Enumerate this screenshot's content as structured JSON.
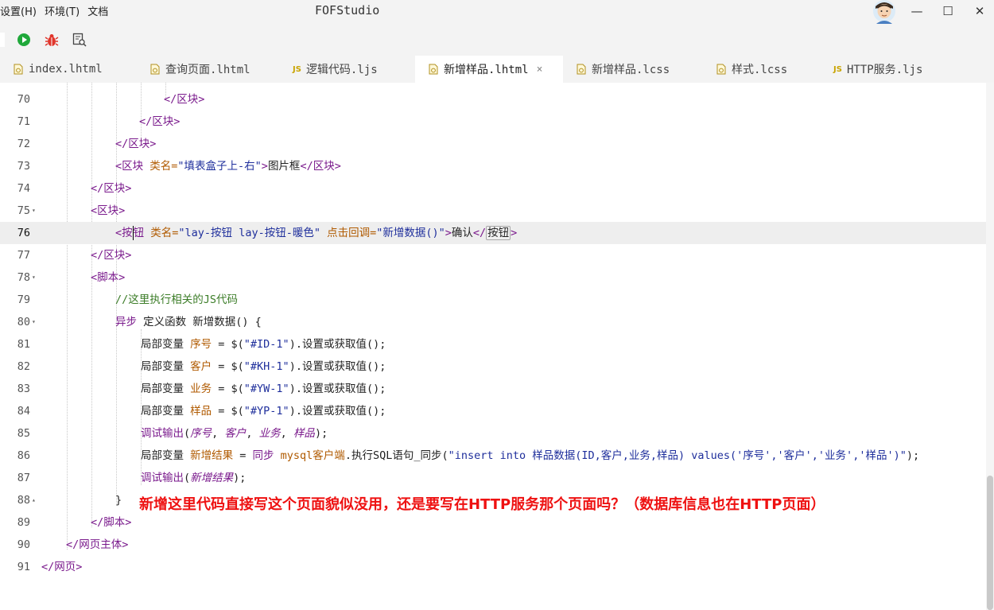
{
  "menu": {
    "settings": "设置(H)",
    "environment": "环境(T)",
    "docs": "文档"
  },
  "app_title": "FOFStudio",
  "window": {
    "minimize": "—",
    "maximize": "☐",
    "close": "✕"
  },
  "tabs": [
    {
      "label": "index.lhtml",
      "kind": "file"
    },
    {
      "label": "查询页面.lhtml",
      "kind": "file"
    },
    {
      "label": "逻辑代码.ljs",
      "kind": "js"
    },
    {
      "label": "新增样品.lhtml",
      "kind": "file",
      "active": true
    },
    {
      "label": "新增样品.lcss",
      "kind": "file"
    },
    {
      "label": "样式.lcss",
      "kind": "file"
    },
    {
      "label": "HTTP服务.ljs",
      "kind": "js"
    }
  ],
  "tab_close": "×",
  "js_badge": "JS",
  "current_line": "76",
  "lines": [
    {
      "n": "70",
      "code": [
        [
          "t",
          "</区块>"
        ]
      ]
    },
    {
      "n": "71",
      "code": [
        [
          "t",
          "</区块>"
        ]
      ]
    },
    {
      "n": "72",
      "code": [
        [
          "t",
          "</区块>"
        ]
      ]
    },
    {
      "n": "73",
      "code": [
        [
          "t",
          "<区块 "
        ],
        [
          "a",
          "类名="
        ],
        [
          "s",
          "\"填表盒子上-右\""
        ],
        [
          "t",
          ">"
        ],
        [
          "p",
          "图片框"
        ],
        [
          "t",
          "</区块>"
        ]
      ]
    },
    {
      "n": "74",
      "code": [
        [
          "t",
          "</区块>"
        ]
      ]
    },
    {
      "n": "75",
      "fold": "▾",
      "code": [
        [
          "t",
          "<区块>"
        ]
      ]
    },
    {
      "n": "76",
      "code": [
        [
          "t",
          "<按"
        ],
        [
          "caret",
          ""
        ],
        [
          "t",
          "钮 "
        ],
        [
          "a",
          "类名="
        ],
        [
          "s",
          "\"lay-按钮 lay-按钮-暖色\" "
        ],
        [
          "a",
          "点击回调="
        ],
        [
          "s",
          "\"新增数据()\""
        ],
        [
          "t",
          ">"
        ],
        [
          "p",
          "确认"
        ],
        [
          "t",
          "</"
        ],
        [
          "hl",
          "按钮"
        ],
        [
          "t",
          ">"
        ]
      ]
    },
    {
      "n": "77",
      "code": [
        [
          "t",
          "</区块>"
        ]
      ]
    },
    {
      "n": "78",
      "fold": "▾",
      "code": [
        [
          "t",
          "<脚本>"
        ]
      ]
    },
    {
      "n": "79",
      "code": [
        [
          "cm",
          "//这里执行相关的JS代码"
        ]
      ]
    },
    {
      "n": "80",
      "fold": "▾",
      "code": [
        [
          "kw",
          "异步 "
        ],
        [
          "p",
          "定义函数 新增数据() {"
        ]
      ]
    },
    {
      "n": "81",
      "code": [
        [
          "p",
          "局部变量 "
        ],
        [
          "a",
          "序号"
        ],
        [
          "p",
          " = $("
        ],
        [
          "s",
          "\"#ID-1\""
        ],
        [
          "p",
          ").设置或获取值();"
        ]
      ]
    },
    {
      "n": "82",
      "code": [
        [
          "p",
          "局部变量 "
        ],
        [
          "a",
          "客户"
        ],
        [
          "p",
          " = $("
        ],
        [
          "s",
          "\"#KH-1\""
        ],
        [
          "p",
          ").设置或获取值();"
        ]
      ]
    },
    {
      "n": "83",
      "code": [
        [
          "p",
          "局部变量 "
        ],
        [
          "a",
          "业务"
        ],
        [
          "p",
          " = $("
        ],
        [
          "s",
          "\"#YW-1\""
        ],
        [
          "p",
          ").设置或获取值();"
        ]
      ]
    },
    {
      "n": "84",
      "code": [
        [
          "p",
          "局部变量 "
        ],
        [
          "a",
          "样品"
        ],
        [
          "p",
          " = $("
        ],
        [
          "s",
          "\"#YP-1\""
        ],
        [
          "p",
          ").设置或获取值();"
        ]
      ]
    },
    {
      "n": "85",
      "code": [
        [
          "kw",
          "调试输出"
        ],
        [
          "p",
          "("
        ],
        [
          "it",
          "序号"
        ],
        [
          "p",
          ", "
        ],
        [
          "it",
          "客户"
        ],
        [
          "p",
          ", "
        ],
        [
          "it",
          "业务"
        ],
        [
          "p",
          ", "
        ],
        [
          "it",
          "样品"
        ],
        [
          "p",
          ");"
        ]
      ]
    },
    {
      "n": "86",
      "code": [
        [
          "p",
          "局部变量 "
        ],
        [
          "a",
          "新增结果"
        ],
        [
          "p",
          " = "
        ],
        [
          "kw",
          "同步 "
        ],
        [
          "a",
          "mysql客户端"
        ],
        [
          "p",
          ".执行SQL语句_同步("
        ],
        [
          "s",
          "\"insert into 样品数据(ID,客户,业务,样品) values('序号','客户','业务','样品')\""
        ],
        [
          "p",
          ");"
        ]
      ]
    },
    {
      "n": "87",
      "code": [
        [
          "kw",
          "调试输出"
        ],
        [
          "p",
          "("
        ],
        [
          "it",
          "新增结果"
        ],
        [
          "p",
          ");"
        ]
      ]
    },
    {
      "n": "88",
      "fold": "▴",
      "code": [
        [
          "p",
          "}"
        ]
      ]
    },
    {
      "n": "89",
      "code": [
        [
          "t",
          "</脚本>"
        ]
      ]
    },
    {
      "n": "90",
      "code": [
        [
          "t",
          "</网页主体>"
        ]
      ]
    },
    {
      "n": "91",
      "code": [
        [
          "t",
          "</网页>"
        ]
      ]
    }
  ],
  "annotation": "新增这里代码直接写这个页面貌似没用，还是要写在HTTP服务那个页面吗？（数据库信息也在HTTP页面）"
}
